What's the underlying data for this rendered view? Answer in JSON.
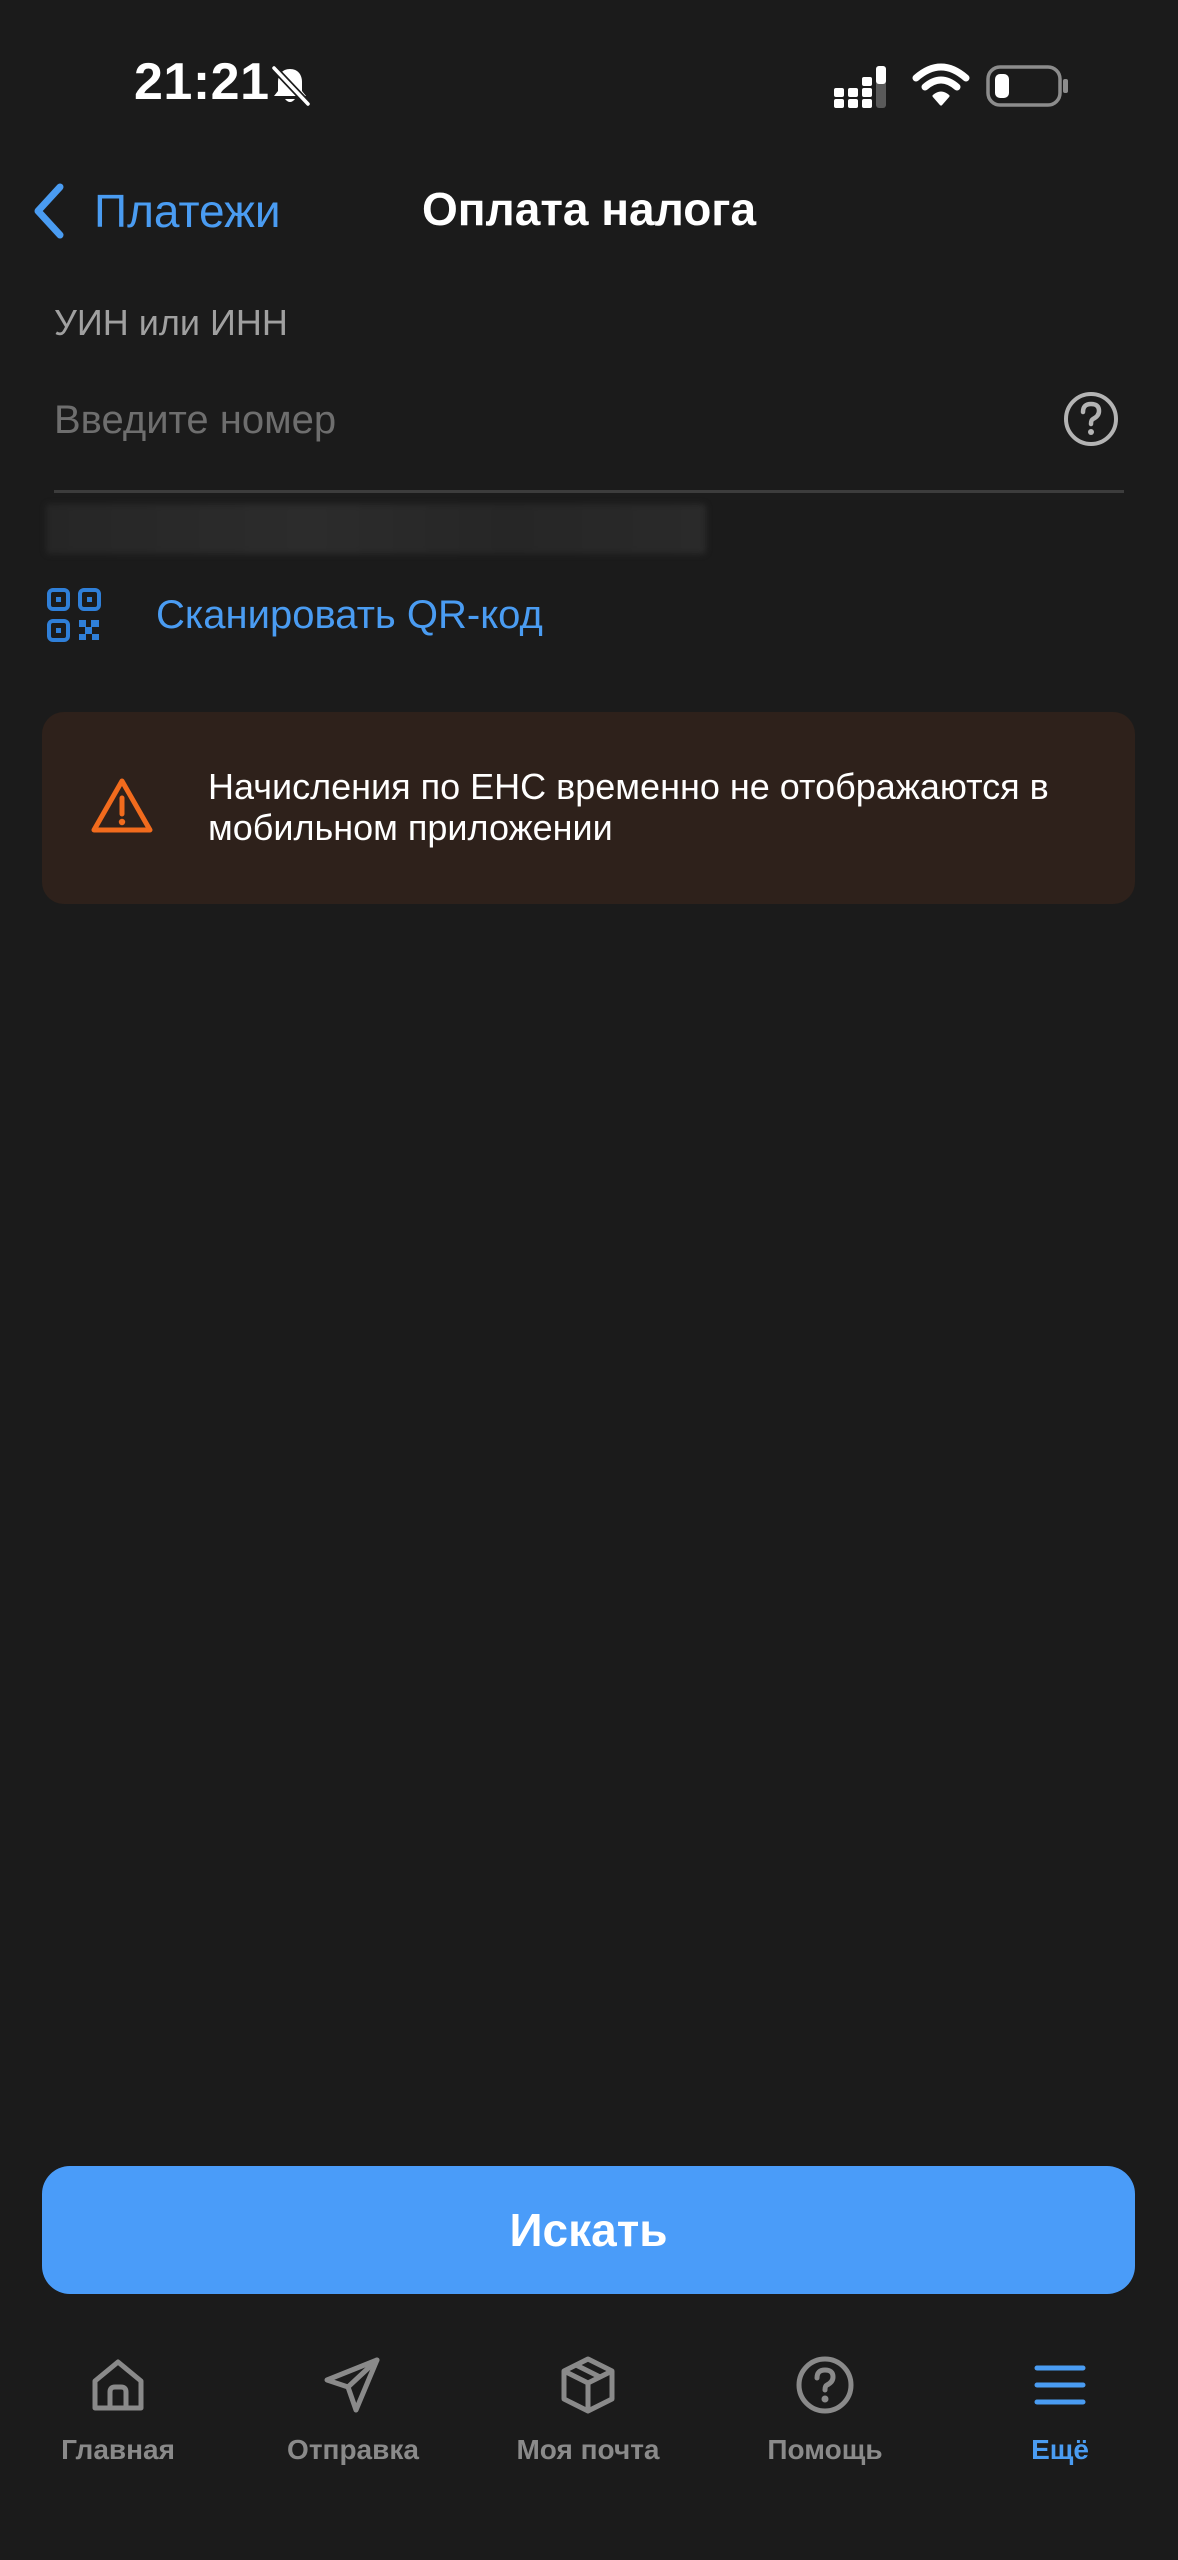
{
  "status_bar": {
    "time": "21:21"
  },
  "nav": {
    "back_label": "Платежи",
    "title": "Оплата налога"
  },
  "form": {
    "label": "УИН или ИНН",
    "placeholder": "Введите номер",
    "value": "",
    "qr_label": "Сканировать QR-код"
  },
  "warning": {
    "text": "Начисления по ЕНС временно не отображаются в мобильном приложении"
  },
  "search_button": {
    "label": "Искать"
  },
  "tabs": [
    {
      "label": "Главная",
      "icon": "home-icon",
      "active": false
    },
    {
      "label": "Отправка",
      "icon": "send-icon",
      "active": false
    },
    {
      "label": "Моя почта",
      "icon": "package-icon",
      "active": false
    },
    {
      "label": "Помощь",
      "icon": "help-icon",
      "active": false
    },
    {
      "label": "Ещё",
      "icon": "menu-icon",
      "active": true
    }
  ],
  "colors": {
    "background": "#1b1b1b",
    "accent": "#4a9cf2",
    "button": "#4a9cf9",
    "warning_bg": "#2e211b",
    "warning_icon": "#f26b1d",
    "inactive_tab": "#8a8a8a"
  }
}
